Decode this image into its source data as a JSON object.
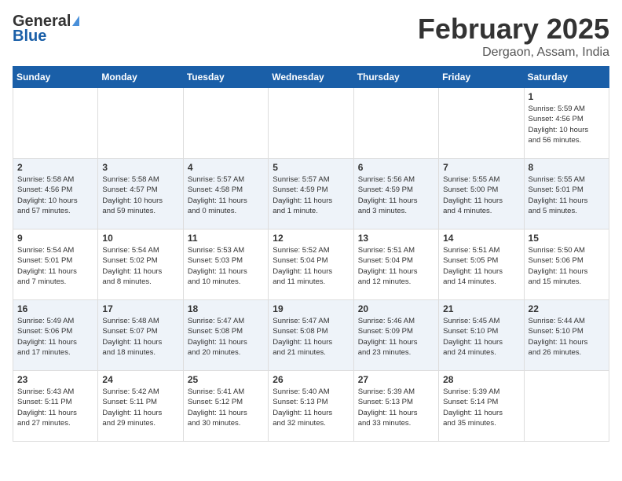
{
  "header": {
    "logo_general": "General",
    "logo_blue": "Blue",
    "month": "February 2025",
    "location": "Dergaon, Assam, India"
  },
  "weekdays": [
    "Sunday",
    "Monday",
    "Tuesday",
    "Wednesday",
    "Thursday",
    "Friday",
    "Saturday"
  ],
  "weeks": [
    [
      {
        "day": "",
        "detail": ""
      },
      {
        "day": "",
        "detail": ""
      },
      {
        "day": "",
        "detail": ""
      },
      {
        "day": "",
        "detail": ""
      },
      {
        "day": "",
        "detail": ""
      },
      {
        "day": "",
        "detail": ""
      },
      {
        "day": "1",
        "detail": "Sunrise: 5:59 AM\nSunset: 4:56 PM\nDaylight: 10 hours\nand 56 minutes."
      }
    ],
    [
      {
        "day": "2",
        "detail": "Sunrise: 5:58 AM\nSunset: 4:56 PM\nDaylight: 10 hours\nand 57 minutes."
      },
      {
        "day": "3",
        "detail": "Sunrise: 5:58 AM\nSunset: 4:57 PM\nDaylight: 10 hours\nand 59 minutes."
      },
      {
        "day": "4",
        "detail": "Sunrise: 5:57 AM\nSunset: 4:58 PM\nDaylight: 11 hours\nand 0 minutes."
      },
      {
        "day": "5",
        "detail": "Sunrise: 5:57 AM\nSunset: 4:59 PM\nDaylight: 11 hours\nand 1 minute."
      },
      {
        "day": "6",
        "detail": "Sunrise: 5:56 AM\nSunset: 4:59 PM\nDaylight: 11 hours\nand 3 minutes."
      },
      {
        "day": "7",
        "detail": "Sunrise: 5:55 AM\nSunset: 5:00 PM\nDaylight: 11 hours\nand 4 minutes."
      },
      {
        "day": "8",
        "detail": "Sunrise: 5:55 AM\nSunset: 5:01 PM\nDaylight: 11 hours\nand 5 minutes."
      }
    ],
    [
      {
        "day": "9",
        "detail": "Sunrise: 5:54 AM\nSunset: 5:01 PM\nDaylight: 11 hours\nand 7 minutes."
      },
      {
        "day": "10",
        "detail": "Sunrise: 5:54 AM\nSunset: 5:02 PM\nDaylight: 11 hours\nand 8 minutes."
      },
      {
        "day": "11",
        "detail": "Sunrise: 5:53 AM\nSunset: 5:03 PM\nDaylight: 11 hours\nand 10 minutes."
      },
      {
        "day": "12",
        "detail": "Sunrise: 5:52 AM\nSunset: 5:04 PM\nDaylight: 11 hours\nand 11 minutes."
      },
      {
        "day": "13",
        "detail": "Sunrise: 5:51 AM\nSunset: 5:04 PM\nDaylight: 11 hours\nand 12 minutes."
      },
      {
        "day": "14",
        "detail": "Sunrise: 5:51 AM\nSunset: 5:05 PM\nDaylight: 11 hours\nand 14 minutes."
      },
      {
        "day": "15",
        "detail": "Sunrise: 5:50 AM\nSunset: 5:06 PM\nDaylight: 11 hours\nand 15 minutes."
      }
    ],
    [
      {
        "day": "16",
        "detail": "Sunrise: 5:49 AM\nSunset: 5:06 PM\nDaylight: 11 hours\nand 17 minutes."
      },
      {
        "day": "17",
        "detail": "Sunrise: 5:48 AM\nSunset: 5:07 PM\nDaylight: 11 hours\nand 18 minutes."
      },
      {
        "day": "18",
        "detail": "Sunrise: 5:47 AM\nSunset: 5:08 PM\nDaylight: 11 hours\nand 20 minutes."
      },
      {
        "day": "19",
        "detail": "Sunrise: 5:47 AM\nSunset: 5:08 PM\nDaylight: 11 hours\nand 21 minutes."
      },
      {
        "day": "20",
        "detail": "Sunrise: 5:46 AM\nSunset: 5:09 PM\nDaylight: 11 hours\nand 23 minutes."
      },
      {
        "day": "21",
        "detail": "Sunrise: 5:45 AM\nSunset: 5:10 PM\nDaylight: 11 hours\nand 24 minutes."
      },
      {
        "day": "22",
        "detail": "Sunrise: 5:44 AM\nSunset: 5:10 PM\nDaylight: 11 hours\nand 26 minutes."
      }
    ],
    [
      {
        "day": "23",
        "detail": "Sunrise: 5:43 AM\nSunset: 5:11 PM\nDaylight: 11 hours\nand 27 minutes."
      },
      {
        "day": "24",
        "detail": "Sunrise: 5:42 AM\nSunset: 5:11 PM\nDaylight: 11 hours\nand 29 minutes."
      },
      {
        "day": "25",
        "detail": "Sunrise: 5:41 AM\nSunset: 5:12 PM\nDaylight: 11 hours\nand 30 minutes."
      },
      {
        "day": "26",
        "detail": "Sunrise: 5:40 AM\nSunset: 5:13 PM\nDaylight: 11 hours\nand 32 minutes."
      },
      {
        "day": "27",
        "detail": "Sunrise: 5:39 AM\nSunset: 5:13 PM\nDaylight: 11 hours\nand 33 minutes."
      },
      {
        "day": "28",
        "detail": "Sunrise: 5:39 AM\nSunset: 5:14 PM\nDaylight: 11 hours\nand 35 minutes."
      },
      {
        "day": "",
        "detail": ""
      }
    ]
  ]
}
